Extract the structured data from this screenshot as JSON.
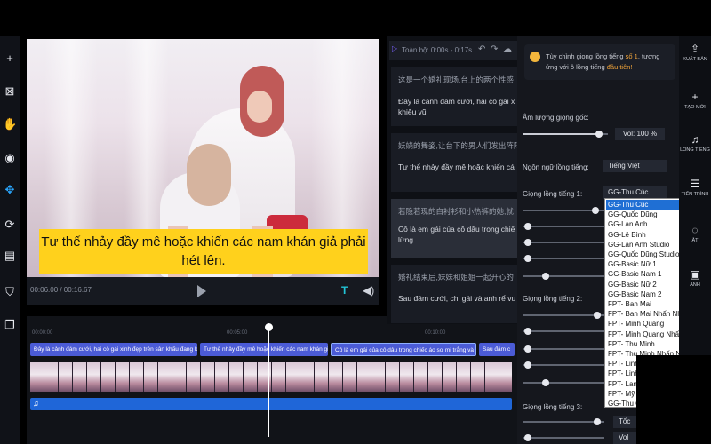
{
  "left_tools": [
    {
      "name": "add-icon",
      "glyph": "+"
    },
    {
      "name": "crop-icon",
      "glyph": "⊠"
    },
    {
      "name": "hand-icon",
      "glyph": "✋"
    },
    {
      "name": "eye-icon",
      "glyph": "◉"
    },
    {
      "name": "move-icon",
      "glyph": "✥"
    },
    {
      "name": "loop-icon",
      "glyph": "⟳"
    },
    {
      "name": "subtitle-icon",
      "glyph": "▤"
    },
    {
      "name": "export-frame-icon",
      "glyph": "⛉"
    },
    {
      "name": "copy-icon",
      "glyph": "❐"
    }
  ],
  "preview": {
    "subtitle_line1": "Tư thế nhảy đầy mê hoặc khiến các nam khán giả phải",
    "subtitle_line2": "hét lên.",
    "timecode": "00:06.00 / 00:16.67"
  },
  "timeline": {
    "ticks": [
      "00:00:00",
      "00:05:00",
      "00:10:00"
    ],
    "clips": [
      "Đây là cảnh đám cưới, hai cô gái xinh đẹp trên sân khấu đang k",
      "Tư thế nhảy đầy mê hoặc khiến các nam khán giả",
      "Cô là em gái của cô dâu trong chiếc áo sơ mi trắng và c",
      "Sau đám c"
    ]
  },
  "transcript": {
    "range": "Toàn bộ: 0:00s - 0:17s",
    "segments": [
      {
        "zh": "这是一个婚礼现场,台上的两个性感",
        "vi": "Đây là cảnh đám cưới, hai cô gái x khiêu vũ"
      },
      {
        "zh": "妖娆的舞姿,让台下的男人们发出阵阵",
        "vi": "Tư thế nhảy đầy mê hoặc khiến cá"
      },
      {
        "zh": "若隐若现的白衬衫和小热裤的她,就",
        "vi": "Cô là em gái của cô dâu trong chiế lừng."
      },
      {
        "zh": "婚礼结束后,妹妹和姐姐一起开心的",
        "vi": "Sau đám cưới, chị gái và anh rể vu"
      }
    ]
  },
  "settings": {
    "tip_prefix": "Tùy chỉnh giọng lồng tiếng",
    "tip_num": "số 1",
    "tip_mid": ", tương ứng với ô lồng tiếng",
    "tip_end": "đầu tiên!",
    "orig_volume_label": "Âm lượng giọng gốc:",
    "orig_volume_value": "Vol: 100 %",
    "orig_volume_level": 0.9,
    "dub_language_label": "Ngôn ngữ lồng tiếng:",
    "dub_language_value": "Tiếng Việt",
    "voice1_label": "Giọng lồng tiếng 1:",
    "voice1_value": "GG-Thu Cúc",
    "voice2_label": "Giọng lồng tiếng 2:",
    "voice3_label": "Giọng lồng tiếng 3:",
    "voice3_value": "GG-Thu C",
    "toc_label": "Tốc",
    "vol_label": "Vol"
  },
  "voice_options": [
    "GG-Thu Cúc",
    "GG-Quốc Dũng",
    "GG-Lan Anh",
    "GG-Lê Bình",
    "GG-Lan Anh Studio",
    "GG-Quốc Dũng Studio",
    "GG-Basic Nữ 1",
    "GG-Basic Nam 1",
    "GG-Basic Nữ 2",
    "GG-Basic Nam 2",
    "FPT- Ban Mai",
    "FPT- Ban Mai Nhấn Nhá",
    "FPT- Minh Quang",
    "FPT- Minh Quang Nhấn Nhá",
    "FPT- Thu Minh",
    "FPT- Thu Minh Nhấn Nhá",
    "FPT- Linh",
    "FPT- Linh",
    "FPT- Lan",
    "FPT- Mỹ",
    "GG-Thu C"
  ],
  "right_bar": {
    "export_label": "XUẤT BẢN",
    "new_label": "TẠO MỚI",
    "dub_label": "LỒNG TIẾNG",
    "step_label": "TIẾN TRÌNH",
    "adjust_label": "ẬT",
    "extra_label": "ANH"
  }
}
